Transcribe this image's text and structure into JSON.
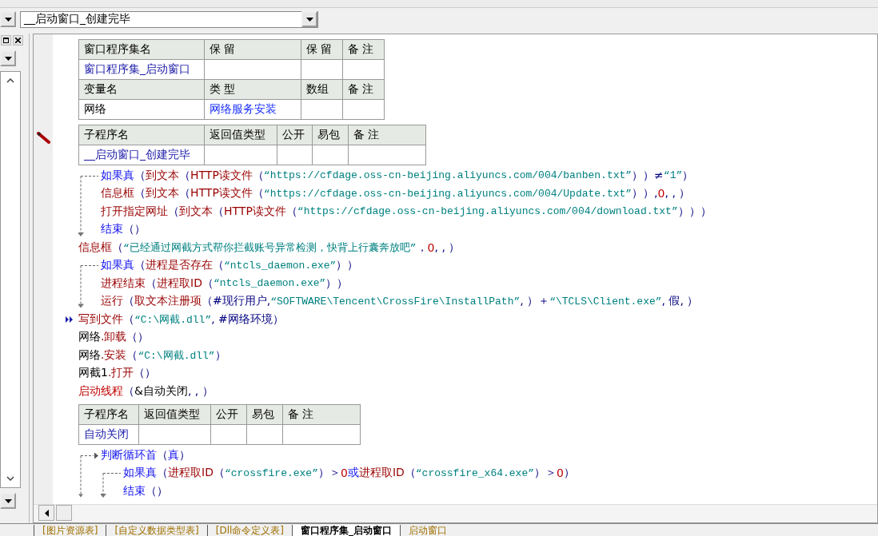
{
  "routine_selector": {
    "value": "__启动窗口_创建完毕"
  },
  "editor": {
    "sections": [
      {
        "kind": "table",
        "header": [
          "窗口程序集名",
          "保 留",
          "保 留",
          "备 注"
        ],
        "rows": [
          [
            "窗口程序集_启动窗口"
          ]
        ],
        "header2": [
          "变量名",
          "类 型",
          "数组",
          "备 注"
        ],
        "rows2": [
          [
            "网络",
            "网络服务安装"
          ]
        ]
      },
      {
        "kind": "sub",
        "header": [
          "子程序名",
          "返回值类型",
          "公开",
          "易包",
          "备 注"
        ],
        "rows": [
          [
            "__启动窗口_创建完毕"
          ]
        ]
      },
      {
        "kind": "code",
        "statements": [
          {
            "kind": "if",
            "current": false,
            "tokens": [
              {
                "kind": "kw",
                "text": "如果真"
              },
              {
                "kind": "op",
                "text": "（"
              },
              {
                "kind": "fn",
                "text": "到文本"
              },
              {
                "kind": "op",
                "text": "（"
              },
              {
                "kind": "fn",
                "text": "HTTP读文件"
              },
              {
                "kind": "op",
                "text": "（"
              },
              {
                "kind": "str",
                "text": "“https://cfdage.oss-cn-beijing.aliyuncs.com/004/banben.txt”"
              },
              {
                "kind": "op",
                "text": "））≠ "
              },
              {
                "kind": "str",
                "text": "“1”"
              },
              {
                "kind": "op",
                "text": "）"
              }
            ],
            "children": [
              {
                "kind": "line",
                "current": false,
                "tokens": [
                  {
                    "kind": "fn",
                    "text": "信息框"
                  },
                  {
                    "kind": "op",
                    "text": "（"
                  },
                  {
                    "kind": "fn",
                    "text": "到文本"
                  },
                  {
                    "kind": "op",
                    "text": "（"
                  },
                  {
                    "kind": "fn",
                    "text": "HTTP读文件"
                  },
                  {
                    "kind": "op",
                    "text": "（"
                  },
                  {
                    "kind": "str",
                    "text": "“https://cfdage.oss-cn-beijing.aliyuncs.com/004/Update.txt”"
                  },
                  {
                    "kind": "op",
                    "text": "））, "
                  },
                  {
                    "kind": "num",
                    "text": "0"
                  },
                  {
                    "kind": "op",
                    "text": ", , ）"
                  }
                ]
              },
              {
                "kind": "line",
                "current": false,
                "tokens": [
                  {
                    "kind": "fn",
                    "text": "打开指定网址"
                  },
                  {
                    "kind": "op",
                    "text": "（"
                  },
                  {
                    "kind": "fn",
                    "text": "到文本"
                  },
                  {
                    "kind": "op",
                    "text": "（"
                  },
                  {
                    "kind": "fn",
                    "text": "HTTP读文件"
                  },
                  {
                    "kind": "op",
                    "text": "（"
                  },
                  {
                    "kind": "str",
                    "text": "“https://cfdage.oss-cn-beijing.aliyuncs.com/004/download.txt”"
                  },
                  {
                    "kind": "op",
                    "text": "）））"
                  }
                ]
              },
              {
                "kind": "line",
                "current": false,
                "tokens": [
                  {
                    "kind": "kw",
                    "text": "结束"
                  },
                  {
                    "kind": "op",
                    "text": "（）"
                  }
                ]
              }
            ]
          },
          {
            "kind": "line",
            "current": false,
            "tokens": [
              {
                "kind": "fn",
                "text": "信息框"
              },
              {
                "kind": "op",
                "text": "（"
              },
              {
                "kind": "str",
                "text": "“已经通过网截方式帮你拦截账号异常检测，快背上行囊奔放吧”"
              },
              {
                "kind": "op",
                "text": "， "
              },
              {
                "kind": "num",
                "text": "0"
              },
              {
                "kind": "op",
                "text": ", , ）"
              }
            ]
          },
          {
            "kind": "if",
            "current": false,
            "tokens": [
              {
                "kind": "kw",
                "text": "如果真"
              },
              {
                "kind": "op",
                "text": "（"
              },
              {
                "kind": "fn",
                "text": "进程是否存在"
              },
              {
                "kind": "op",
                "text": "（"
              },
              {
                "kind": "str",
                "text": "“ntcls_daemon.exe”"
              },
              {
                "kind": "op",
                "text": "））"
              }
            ],
            "children": [
              {
                "kind": "line",
                "current": false,
                "tokens": [
                  {
                    "kind": "fn",
                    "text": "进程结束"
                  },
                  {
                    "kind": "op",
                    "text": "（"
                  },
                  {
                    "kind": "fn",
                    "text": "进程取ID"
                  },
                  {
                    "kind": "op",
                    "text": "（"
                  },
                  {
                    "kind": "str",
                    "text": "“ntcls_daemon.exe”"
                  },
                  {
                    "kind": "op",
                    "text": "））"
                  }
                ]
              },
              {
                "kind": "line",
                "current": false,
                "tokens": [
                  {
                    "kind": "fn",
                    "text": "运行"
                  },
                  {
                    "kind": "op",
                    "text": "（"
                  },
                  {
                    "kind": "fn",
                    "text": "取文本注册项"
                  },
                  {
                    "kind": "op",
                    "text": "（#现行用户, "
                  },
                  {
                    "kind": "str",
                    "text": "“SOFTWARE\\Tencent\\CrossFire\\InstallPath”"
                  },
                  {
                    "kind": "op",
                    "text": ", ）＋ "
                  },
                  {
                    "kind": "str",
                    "text": "“\\TCLS\\Client.exe”"
                  },
                  {
                    "kind": "op",
                    "text": ", 假, ）"
                  }
                ]
              }
            ]
          },
          {
            "kind": "line",
            "current": true,
            "tokens": [
              {
                "kind": "fn",
                "text": "写到文件"
              },
              {
                "kind": "op",
                "text": "（"
              },
              {
                "kind": "str",
                "text": "“C:\\网截.dll”"
              },
              {
                "kind": "op",
                "text": ", #网络环境）"
              }
            ]
          },
          {
            "kind": "line",
            "current": false,
            "tokens": [
              {
                "kind": "txt",
                "text": "网络"
              },
              {
                "kind": "fn",
                "text": ".卸载"
              },
              {
                "kind": "op",
                "text": "（）"
              }
            ]
          },
          {
            "kind": "line",
            "current": false,
            "tokens": [
              {
                "kind": "txt",
                "text": "网络"
              },
              {
                "kind": "fn",
                "text": ".安装"
              },
              {
                "kind": "op",
                "text": "（"
              },
              {
                "kind": "str",
                "text": "“C:\\网截.dll”"
              },
              {
                "kind": "op",
                "text": "）"
              }
            ]
          },
          {
            "kind": "line",
            "current": false,
            "tokens": [
              {
                "kind": "txt",
                "text": "网截1"
              },
              {
                "kind": "fn",
                "text": ".打开"
              },
              {
                "kind": "op",
                "text": "（）"
              }
            ]
          },
          {
            "kind": "line",
            "current": false,
            "tokens": [
              {
                "kind": "num",
                "text": "启动线程"
              },
              {
                "kind": "op",
                "text": "（"
              },
              {
                "kind": "txt",
                "text": "&自动关闭"
              },
              {
                "kind": "op",
                "text": ", , ）"
              }
            ]
          }
        ]
      },
      {
        "kind": "sub",
        "header": [
          "子程序名",
          "返回值类型",
          "公开",
          "易包",
          "备 注"
        ],
        "rows": [
          [
            "自动关闭"
          ]
        ]
      },
      {
        "kind": "code",
        "statements": [
          {
            "kind": "loop",
            "current": false,
            "tokens": [
              {
                "kind": "kw",
                "text": "判断循环首"
              },
              {
                "kind": "op",
                "text": "（"
              },
              {
                "kind": "kw",
                "text": "真"
              },
              {
                "kind": "op",
                "text": "）"
              }
            ],
            "children": [
              {
                "kind": "if",
                "current": false,
                "tokens": [
                  {
                    "kind": "kw",
                    "text": "如果真"
                  },
                  {
                    "kind": "op",
                    "text": "（"
                  },
                  {
                    "kind": "fn",
                    "text": "进程取ID"
                  },
                  {
                    "kind": "op",
                    "text": "（"
                  },
                  {
                    "kind": "str",
                    "text": "“crossfire.exe”"
                  },
                  {
                    "kind": "op",
                    "text": "）＞ "
                  },
                  {
                    "kind": "num",
                    "text": "0"
                  },
                  {
                    "kind": "kw",
                    "text": " 或 "
                  },
                  {
                    "kind": "fn",
                    "text": "进程取ID"
                  },
                  {
                    "kind": "op",
                    "text": "（"
                  },
                  {
                    "kind": "str",
                    "text": "“crossfire_x64.exe”"
                  },
                  {
                    "kind": "op",
                    "text": "）＞ "
                  },
                  {
                    "kind": "num",
                    "text": "0"
                  },
                  {
                    "kind": "op",
                    "text": "）"
                  }
                ],
                "children": [
                  {
                    "kind": "line",
                    "current": false,
                    "tokens": [
                      {
                        "kind": "kw",
                        "text": "结束"
                      },
                      {
                        "kind": "op",
                        "text": "（）"
                      }
                    ]
                  }
                ]
              }
            ]
          }
        ]
      }
    ]
  },
  "bottom_tabs": [
    {
      "label": "[图片资源表]",
      "selected": false
    },
    {
      "label": "[自定义数据类型表]",
      "selected": false
    },
    {
      "label": "[Dll命令定义表]",
      "selected": false
    },
    {
      "label": "窗口程序集_启动窗口",
      "selected": true
    },
    {
      "label": "启动窗口",
      "selected": false
    }
  ]
}
